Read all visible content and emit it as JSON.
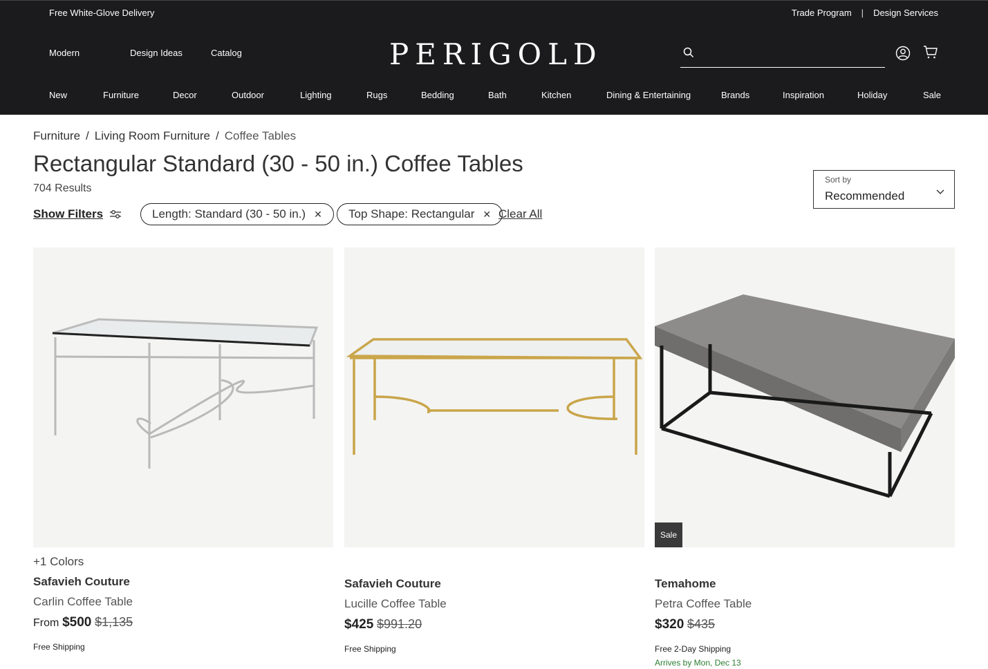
{
  "topbar": {
    "promo": "Free White-Glove Delivery",
    "trade": "Trade Program",
    "separator": "|",
    "design": "Design Services"
  },
  "header": {
    "logo": "PERIGOLD",
    "subnav": [
      "Modern",
      "Design Ideas",
      "Catalog"
    ],
    "search_placeholder": "",
    "categories": [
      "New",
      "Furniture",
      "Decor",
      "Outdoor",
      "Lighting",
      "Rugs",
      "Bedding",
      "Bath",
      "Kitchen",
      "Dining & Entertaining",
      "Brands",
      "Inspiration",
      "Holiday",
      "Sale"
    ]
  },
  "breadcrumb": {
    "items": [
      "Furniture",
      "Living Room Furniture",
      "Coffee Tables"
    ],
    "separator": "/"
  },
  "page": {
    "title": "Rectangular Standard (30 - 50 in.) Coffee Tables",
    "results": "704 Results"
  },
  "filters": {
    "show_label": "Show Filters",
    "chips": [
      "Length: Standard (30 - 50 in.)",
      "Top Shape: Rectangular"
    ],
    "clear_label": "Clear All"
  },
  "sort": {
    "label": "Sort by",
    "value": "Recommended"
  },
  "products": [
    {
      "colors": "+1 Colors",
      "brand": "Safavieh Couture",
      "name": "Carlin Coffee Table",
      "from": "From",
      "price": "$500",
      "was": "$1,135",
      "shipping": "Free Shipping"
    },
    {
      "brand": "Safavieh Couture",
      "name": "Lucille Coffee Table",
      "price": "$425",
      "was": "$991.20",
      "shipping": "Free Shipping"
    },
    {
      "badge": "Sale",
      "brand": "Temahome",
      "name": "Petra Coffee Table",
      "price": "$320",
      "was": "$435",
      "shipping": "Free 2-Day Shipping",
      "arrives": "Arrives by Mon, Dec 13"
    }
  ],
  "colors": {
    "header_bg": "#1b1a1c",
    "arrives_green": "#2e7d32"
  }
}
